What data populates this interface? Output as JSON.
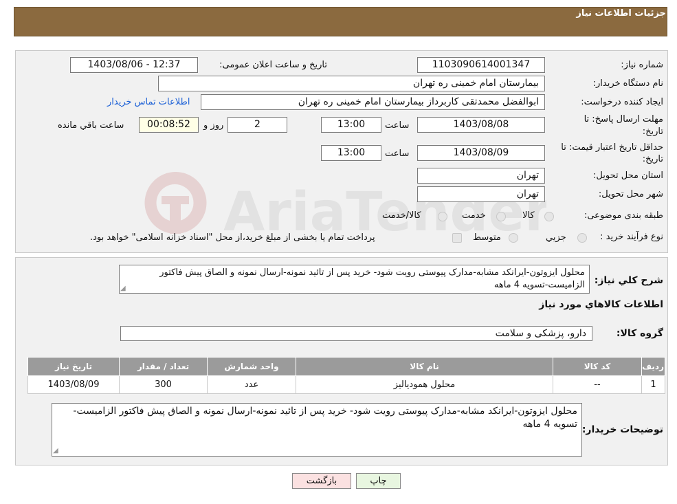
{
  "header": {
    "title": "جزئیات اطلاعات نیاز"
  },
  "form": {
    "need_number_label": "شماره نیاز:",
    "need_number": "1103090614001347",
    "announce_label": "تاریخ و ساعت اعلان عمومی:",
    "announce_value": "1403/08/06 - 12:37",
    "buyer_org_label": "نام دستگاه خریدار:",
    "buyer_org": "بیمارستان امام خمینی ره  تهران",
    "creator_label": "ایجاد کننده درخواست:",
    "creator": "ابوالفضل محمدتقی کاربرداز بیمارستان امام خمینی ره  تهران",
    "contact_link": "اطلاعات تماس خریدار",
    "deadline_label_1": "مهلت ارسال پاسخ: تا",
    "deadline_label_2": "تاریخ:",
    "deadline_date": "1403/08/08",
    "time_label": "ساعت",
    "deadline_time": "13:00",
    "days_value": "2",
    "days_label": "روز و",
    "remaining_time": "00:08:52",
    "remaining_label": "ساعت باقي مانده",
    "validity_label_1": "حداقل تاریخ اعتبار قیمت: تا",
    "validity_label_2": "تاریخ:",
    "validity_date": "1403/08/09",
    "validity_time": "13:00",
    "province_label": "استان محل تحویل:",
    "province": "تهران",
    "city_label": "شهر محل تحویل:",
    "city": "تهران",
    "category_label": "طبقه بندی موضوعی:",
    "category_options": [
      "کالا",
      "خدمت",
      "کالا/خدمت"
    ],
    "process_label": "نوع فرآیند خرید :",
    "process_options": [
      "جزیي",
      "متوسط"
    ],
    "process_note": "پرداخت تمام یا بخشی از مبلغ خرید،از محل \"اسناد خزانه اسلامی\" خواهد بود."
  },
  "details": {
    "summary_label": "شرح کلي نياز:",
    "summary_text": "محلول ایزوتون-ایرانکد مشابه-مدارک پیوستی رویت شود- خرید پس از تائید نمونه-ارسال نمونه و الصاق پیش فاکتور الزامیست-تسویه 4 ماهه",
    "goods_info_title": "اطلاعات کالاهاي مورد نياز",
    "group_label": "گروه کالا:",
    "group_value": "دارو، پزشکی و سلامت",
    "table": {
      "headers": [
        "رديف",
        "کد کالا",
        "نام کالا",
        "واحد شمارش",
        "تعداد / مقدار",
        "تاریخ نیاز"
      ],
      "rows": [
        [
          "1",
          "--",
          "محلول همودیالیز",
          "عدد",
          "300",
          "1403/08/09"
        ]
      ]
    },
    "buyer_notes_label": "توضیحات خریدار:",
    "buyer_notes": "محلول ایزوتون-ایرانکد مشابه-مدارک پیوستی رویت شود- خرید پس از تائید نمونه-ارسال نمونه و الصاق پیش فاکتور الزامیست-تسویه 4 ماهه"
  },
  "buttons": {
    "print": "چاپ",
    "back": "بازگشت"
  },
  "watermark": {
    "text": "AriaTender.neT"
  },
  "colors": {
    "header_bg": "#8b6a3f",
    "table_header_bg": "#9b9b9b",
    "link": "#1a5fd6",
    "back_button_bg": "#fbe1e1",
    "print_button_bg": "#e8f6e0"
  }
}
